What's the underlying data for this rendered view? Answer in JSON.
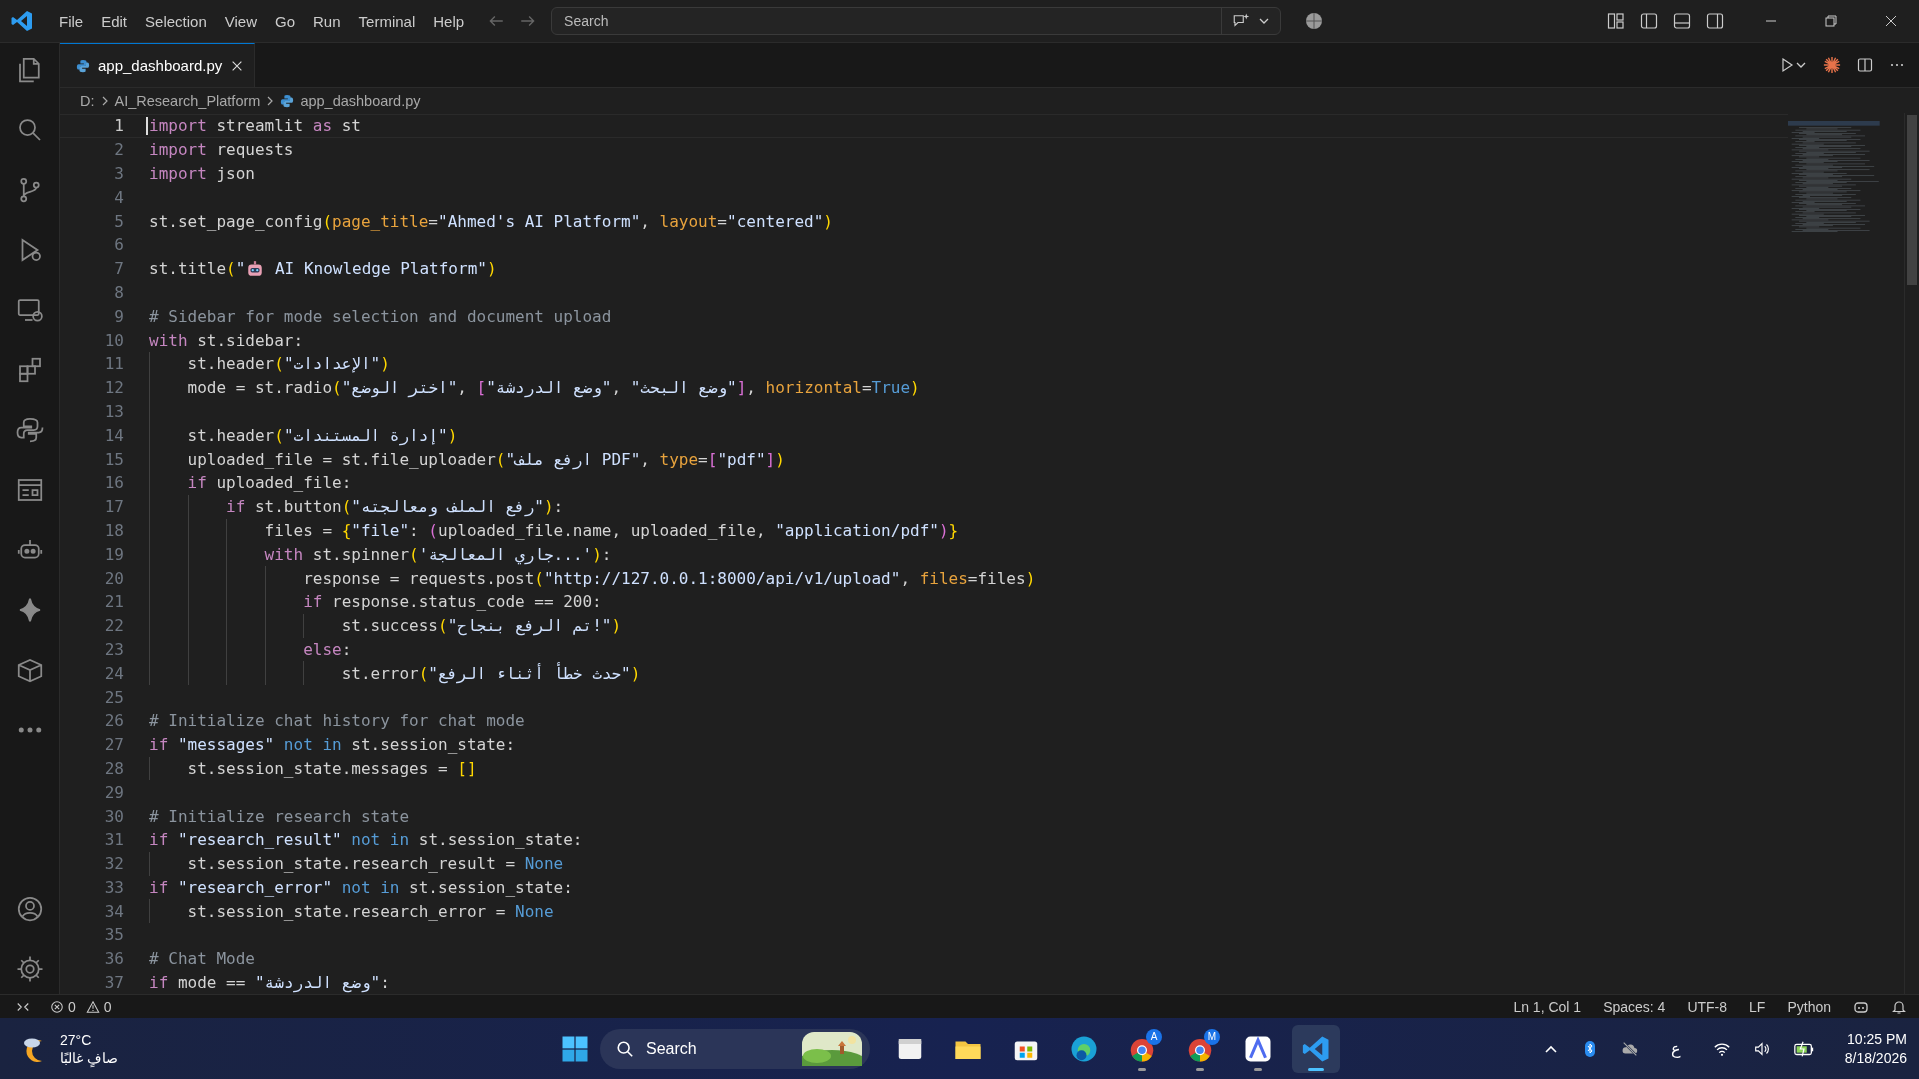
{
  "title_bar": {
    "menu": [
      "File",
      "Edit",
      "Selection",
      "View",
      "Go",
      "Run",
      "Terminal",
      "Help"
    ],
    "command_center": {
      "placeholder": "Search"
    }
  },
  "activity_bar": {
    "top": [
      {
        "kind": "files",
        "selected": false
      },
      {
        "kind": "search",
        "selected": false
      },
      {
        "kind": "branch",
        "selected": false
      },
      {
        "kind": "play-bug",
        "selected": false
      },
      {
        "kind": "monitor",
        "selected": false
      },
      {
        "kind": "blocks",
        "selected": false
      },
      {
        "kind": "python",
        "selected": false
      },
      {
        "kind": "panel",
        "selected": false
      },
      {
        "kind": "robot",
        "selected": false
      },
      {
        "kind": "sparkle",
        "selected": false
      },
      {
        "kind": "box",
        "selected": false
      },
      {
        "kind": "more",
        "selected": false
      }
    ],
    "bottom": [
      {
        "kind": "account",
        "selected": false
      },
      {
        "kind": "settings",
        "selected": false
      }
    ]
  },
  "tabs": [
    {
      "label": "app_dashboard.py",
      "selected": true
    }
  ],
  "breadcrumbs": [
    "D:",
    "AI_Research_Platform",
    "app_dashboard.py"
  ],
  "editor": {
    "lines": [
      {
        "number": "1",
        "current": true,
        "tokens": [
          {
            "kind": "kw",
            "text": "import"
          },
          {
            "kind": "plain",
            "text": " streamlit "
          },
          {
            "kind": "kw",
            "text": "as"
          },
          {
            "kind": "plain",
            "text": " st"
          }
        ]
      },
      {
        "number": "2",
        "current": false,
        "tokens": [
          {
            "kind": "kw",
            "text": "import"
          },
          {
            "kind": "plain",
            "text": " requests"
          }
        ]
      },
      {
        "number": "3",
        "current": false,
        "tokens": [
          {
            "kind": "kw",
            "text": "import"
          },
          {
            "kind": "plain",
            "text": " json"
          }
        ]
      },
      {
        "number": "4",
        "current": false
      },
      {
        "number": "5",
        "current": false,
        "tokens": [
          {
            "kind": "plain",
            "text": "st.set_page_config"
          },
          {
            "kind": "b1",
            "text": "("
          },
          {
            "kind": "param",
            "text": "page_title"
          },
          {
            "kind": "plain",
            "text": "="
          },
          {
            "kind": "str",
            "text": "\"Ahmed's AI Platform\""
          },
          {
            "kind": "plain",
            "text": ", "
          },
          {
            "kind": "param",
            "text": "layout"
          },
          {
            "kind": "plain",
            "text": "="
          },
          {
            "kind": "str",
            "text": "\"centered\""
          },
          {
            "kind": "b1",
            "text": ")"
          }
        ]
      },
      {
        "number": "6",
        "current": false
      },
      {
        "number": "7",
        "current": false,
        "tokens": [
          {
            "kind": "plain",
            "text": "st.title"
          },
          {
            "kind": "b1",
            "text": "("
          },
          {
            "kind": "str",
            "text": "\""
          },
          {
            "kind": "robot"
          },
          {
            "kind": "str",
            "text": " AI Knowledge Platform\""
          },
          {
            "kind": "b1",
            "text": ")"
          }
        ]
      },
      {
        "number": "8",
        "current": false
      },
      {
        "number": "9",
        "current": false,
        "tokens": [
          {
            "kind": "comment",
            "text": "# Sidebar for mode selection and document upload"
          }
        ]
      },
      {
        "number": "10",
        "current": false,
        "tokens": [
          {
            "kind": "kw",
            "text": "with"
          },
          {
            "kind": "plain",
            "text": " st.sidebar:"
          }
        ]
      },
      {
        "number": "11",
        "current": false,
        "tokens": [
          {
            "kind": "plain",
            "text": "    st.header"
          },
          {
            "kind": "b1",
            "text": "("
          },
          {
            "kind": "str",
            "text": "\"الإعدادات\""
          },
          {
            "kind": "b1",
            "text": ")"
          }
        ]
      },
      {
        "number": "12",
        "current": false,
        "tokens": [
          {
            "kind": "plain",
            "text": "    mode = st.radio"
          },
          {
            "kind": "b1",
            "text": "("
          },
          {
            "kind": "str",
            "text": "\"اختر الوضع\""
          },
          {
            "kind": "plain",
            "text": ", "
          },
          {
            "kind": "b2",
            "text": "["
          },
          {
            "kind": "str",
            "text": "\"وضع الدردشة\""
          },
          {
            "kind": "plain",
            "text": ", "
          },
          {
            "kind": "str",
            "text": "\"وضع البحث\""
          },
          {
            "kind": "b2",
            "text": "]"
          },
          {
            "kind": "plain",
            "text": ", "
          },
          {
            "kind": "param",
            "text": "horizontal"
          },
          {
            "kind": "plain",
            "text": "="
          },
          {
            "kind": "const",
            "text": "True"
          },
          {
            "kind": "b1",
            "text": ")"
          }
        ]
      },
      {
        "number": "13",
        "current": false
      },
      {
        "number": "14",
        "current": false,
        "tokens": [
          {
            "kind": "plain",
            "text": "    st.header"
          },
          {
            "kind": "b1",
            "text": "("
          },
          {
            "kind": "str",
            "text": "\"إدارة المستندات\""
          },
          {
            "kind": "b1",
            "text": ")"
          }
        ]
      },
      {
        "number": "15",
        "current": false,
        "tokens": [
          {
            "kind": "plain",
            "text": "    uploaded_file = st.file_uploader"
          },
          {
            "kind": "b1",
            "text": "("
          },
          {
            "kind": "str",
            "text": "\"ارفع ملف PDF\""
          },
          {
            "kind": "plain",
            "text": ", "
          },
          {
            "kind": "param",
            "text": "type"
          },
          {
            "kind": "plain",
            "text": "="
          },
          {
            "kind": "b2",
            "text": "["
          },
          {
            "kind": "str",
            "text": "\"pdf\""
          },
          {
            "kind": "b2",
            "text": "]"
          },
          {
            "kind": "b1",
            "text": ")"
          }
        ]
      },
      {
        "number": "16",
        "current": false,
        "tokens": [
          {
            "kind": "kw",
            "text": "    if"
          },
          {
            "kind": "plain",
            "text": " uploaded_file:"
          }
        ]
      },
      {
        "number": "17",
        "current": false,
        "tokens": [
          {
            "kind": "kw",
            "text": "        if"
          },
          {
            "kind": "plain",
            "text": " st.button"
          },
          {
            "kind": "b1",
            "text": "("
          },
          {
            "kind": "str",
            "text": "\"رفع الملف ومعالجته\""
          },
          {
            "kind": "b1",
            "text": ")"
          },
          {
            "kind": "plain",
            "text": ":"
          }
        ]
      },
      {
        "number": "18",
        "current": false,
        "tokens": [
          {
            "kind": "plain",
            "text": "            files = "
          },
          {
            "kind": "b1",
            "text": "{"
          },
          {
            "kind": "str",
            "text": "\"file\""
          },
          {
            "kind": "plain",
            "text": ": "
          },
          {
            "kind": "b2",
            "text": "("
          },
          {
            "kind": "plain",
            "text": "uploaded_file.name, uploaded_file, "
          },
          {
            "kind": "str",
            "text": "\"application/pdf\""
          },
          {
            "kind": "b2",
            "text": ")"
          },
          {
            "kind": "b1",
            "text": "}"
          }
        ]
      },
      {
        "number": "19",
        "current": false,
        "tokens": [
          {
            "kind": "kw",
            "text": "            with"
          },
          {
            "kind": "plain",
            "text": " st.spinner"
          },
          {
            "kind": "b1",
            "text": "("
          },
          {
            "kind": "str",
            "text": "'جاري المعالجة...'"
          },
          {
            "kind": "b1",
            "text": ")"
          },
          {
            "kind": "plain",
            "text": ":"
          }
        ]
      },
      {
        "number": "20",
        "current": false,
        "tokens": [
          {
            "kind": "plain",
            "text": "                response = requests.post"
          },
          {
            "kind": "b1",
            "text": "("
          },
          {
            "kind": "str",
            "text": "\""
          },
          {
            "kind": "url",
            "text": "http://127.0.0.1:8000/api/v1/upload"
          },
          {
            "kind": "str",
            "text": "\""
          },
          {
            "kind": "plain",
            "text": ", "
          },
          {
            "kind": "param",
            "text": "files"
          },
          {
            "kind": "plain",
            "text": "=files"
          },
          {
            "kind": "b1",
            "text": ")"
          }
        ]
      },
      {
        "number": "21",
        "current": false,
        "tokens": [
          {
            "kind": "kw",
            "text": "                if"
          },
          {
            "kind": "plain",
            "text": " response.status_code == 200:"
          }
        ]
      },
      {
        "number": "22",
        "current": false,
        "tokens": [
          {
            "kind": "plain",
            "text": "                    st.success"
          },
          {
            "kind": "b1",
            "text": "("
          },
          {
            "kind": "str",
            "text": "\"تم الرفع بنجاح!\""
          },
          {
            "kind": "b1",
            "text": ")"
          }
        ]
      },
      {
        "number": "23",
        "current": false,
        "tokens": [
          {
            "kind": "kw",
            "text": "                else"
          },
          {
            "kind": "plain",
            "text": ":"
          }
        ]
      },
      {
        "number": "24",
        "current": false,
        "tokens": [
          {
            "kind": "plain",
            "text": "                    st.error"
          },
          {
            "kind": "b1",
            "text": "("
          },
          {
            "kind": "str",
            "text": "\"حدث خطأ أثناء الرفع\""
          },
          {
            "kind": "b1",
            "text": ")"
          }
        ]
      },
      {
        "number": "25",
        "current": false
      },
      {
        "number": "26",
        "current": false,
        "tokens": [
          {
            "kind": "comment",
            "text": "# Initialize chat history for chat mode"
          }
        ]
      },
      {
        "number": "27",
        "current": false,
        "tokens": [
          {
            "kind": "kw",
            "text": "if "
          },
          {
            "kind": "str",
            "text": "\"messages\""
          },
          {
            "kind": "const",
            "text": " not in"
          },
          {
            "kind": "plain",
            "text": " st.session_state:"
          }
        ]
      },
      {
        "number": "28",
        "current": false,
        "tokens": [
          {
            "kind": "plain",
            "text": "    st.session_state.messages = "
          },
          {
            "kind": "b1",
            "text": "[]"
          }
        ]
      },
      {
        "number": "29",
        "current": false
      },
      {
        "number": "30",
        "current": false,
        "tokens": [
          {
            "kind": "comment",
            "text": "# Initialize research state"
          }
        ]
      },
      {
        "number": "31",
        "current": false,
        "tokens": [
          {
            "kind": "kw",
            "text": "if "
          },
          {
            "kind": "str",
            "text": "\"research_result\""
          },
          {
            "kind": "const",
            "text": " not in"
          },
          {
            "kind": "plain",
            "text": " st.session_state:"
          }
        ]
      },
      {
        "number": "32",
        "current": false,
        "tokens": [
          {
            "kind": "plain",
            "text": "    st.session_state.research_result = "
          },
          {
            "kind": "const",
            "text": "None"
          }
        ]
      },
      {
        "number": "33",
        "current": false,
        "tokens": [
          {
            "kind": "kw",
            "text": "if "
          },
          {
            "kind": "str",
            "text": "\"research_error\""
          },
          {
            "kind": "const",
            "text": " not in"
          },
          {
            "kind": "plain",
            "text": " st.session_state:"
          }
        ]
      },
      {
        "number": "34",
        "current": false,
        "tokens": [
          {
            "kind": "plain",
            "text": "    st.session_state.research_error = "
          },
          {
            "kind": "const",
            "text": "None"
          }
        ]
      },
      {
        "number": "35",
        "current": false
      },
      {
        "number": "36",
        "current": false,
        "tokens": [
          {
            "kind": "comment",
            "text": "# Chat Mode"
          }
        ]
      },
      {
        "number": "37",
        "current": false,
        "tokens": [
          {
            "kind": "kw",
            "text": "if"
          },
          {
            "kind": "plain",
            "text": " mode == "
          },
          {
            "kind": "str",
            "text": "\"وضع الدردشة\""
          },
          {
            "kind": "plain",
            "text": ":"
          }
        ]
      }
    ]
  },
  "status_bar": {
    "errors": "0",
    "warnings": "0",
    "items": [
      "Ln 1, Col 1",
      "Spaces: 4",
      "UTF-8",
      "LF",
      "Python"
    ]
  },
  "taskbar": {
    "weather": {
      "temperature": "27°C",
      "condition": "صافٍ غالبًا"
    },
    "search": {
      "placeholder": "Search"
    },
    "apps": [
      {
        "kind": "window",
        "running": false,
        "selected": false
      },
      {
        "kind": "folder",
        "running": false,
        "selected": false
      },
      {
        "kind": "store",
        "running": false,
        "selected": false
      },
      {
        "kind": "edge",
        "running": false,
        "selected": false
      },
      {
        "kind": "chrome",
        "badge": "A",
        "running": true,
        "selected": false
      },
      {
        "kind": "chrome",
        "badge": "M",
        "running": true,
        "selected": false
      },
      {
        "kind": "a-app",
        "running": true,
        "selected": false
      },
      {
        "kind": "vscode",
        "running": true,
        "selected": true
      }
    ],
    "tray": {
      "language": "ع",
      "time": "10:25 PM",
      "date": "8/18/2026"
    }
  }
}
